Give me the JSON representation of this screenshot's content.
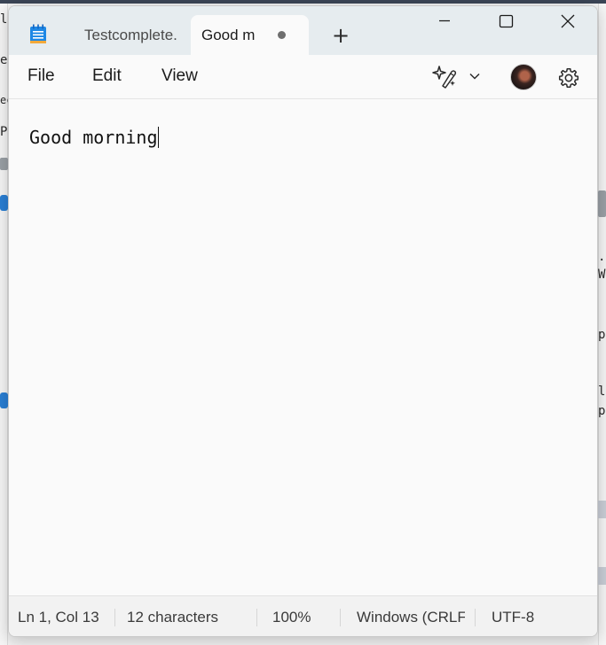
{
  "window": {
    "tabs": [
      {
        "label": "Testcomplete."
      },
      {
        "label": "Good m"
      }
    ],
    "new_tab_glyph": "+"
  },
  "menu": {
    "file": "File",
    "edit": "Edit",
    "view": "View"
  },
  "editor": {
    "content": "Good morning"
  },
  "status": {
    "position": "Ln 1, Col 13",
    "characters": "12 characters",
    "zoom": "100%",
    "line_ending": "Windows (CRLF)",
    "encoding": "UTF-8"
  },
  "background": {
    "fragments": [
      "le",
      "e",
      "ec",
      "P",
      ".",
      "W",
      "p.",
      "l",
      "p."
    ]
  },
  "icons": {
    "app": "notepad-icon",
    "minimize": "minimize-icon",
    "maximize": "maximize-icon",
    "close": "close-icon",
    "copilot": "copilot-sparkle-icon",
    "chevron": "chevron-down-icon",
    "settings": "gear-icon"
  },
  "colors": {
    "titlebar": "#e6ecef",
    "editor_bg": "#fafafa",
    "status_bg": "#f2f2f2",
    "notepad_blue": "#1e88e5"
  }
}
